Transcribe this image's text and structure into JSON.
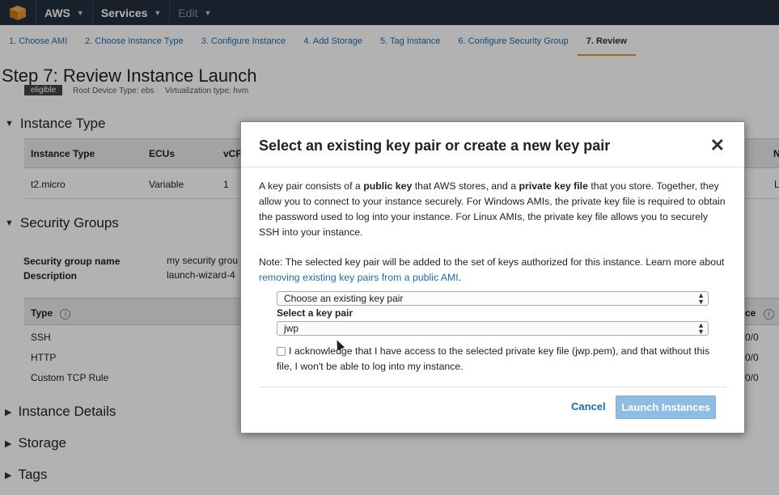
{
  "topnav": {
    "brand": "AWS",
    "services": "Services",
    "edit": "Edit"
  },
  "steps": [
    "1. Choose AMI",
    "2. Choose Instance Type",
    "3. Configure Instance",
    "4. Add Storage",
    "5. Tag Instance",
    "6. Configure Security Group",
    "7. Review"
  ],
  "page": {
    "title": "Step 7: Review Instance Launch",
    "badge": "eligible",
    "root_device": "Root Device Type: ebs",
    "virtualization": "Virtualization type: hvm",
    "instance_type_section": "Instance Type",
    "instance_table": {
      "headers": [
        "Instance Type",
        "ECUs",
        "vCP",
        "N"
      ],
      "row": [
        "t2.micro",
        "Variable",
        "1",
        "L"
      ]
    },
    "security_groups_section": "Security Groups",
    "sg_name_label": "Security group name",
    "sg_name_value": "my security grou",
    "sg_desc_label": "Description",
    "sg_desc_value": "launch-wizard-4",
    "rules_header_type": "Type",
    "rules_header_source": "ce",
    "rules": [
      {
        "type": "SSH",
        "source": "0/0"
      },
      {
        "type": "HTTP",
        "source": "0/0"
      },
      {
        "type": "Custom TCP Rule",
        "source": "0/0"
      }
    ],
    "collapsed_sections": [
      "Instance Details",
      "Storage",
      "Tags"
    ]
  },
  "modal": {
    "title": "Select an existing key pair or create a new key pair",
    "para1_a": "A key pair consists of a ",
    "para1_b": "public key",
    "para1_c": " that AWS stores, and a ",
    "para1_d": "private key file",
    "para1_e": " that you store. Together, they allow you to connect to your instance securely. For Windows AMIs, the private key file is required to obtain the password used to log into your instance. For Linux AMIs, the private key file allows you to securely SSH into your instance.",
    "note_text": "Note: The selected key pair will be added to the set of keys authorized for this instance. Learn more about ",
    "note_link": "removing existing key pairs from a public AMI",
    "note_end": ".",
    "keypair_mode": "Choose an existing key pair",
    "select_label": "Select a key pair",
    "selected_key": "jwp",
    "ack_text": "I acknowledge that I have access to the selected private key file (jwp.pem), and that without this file, I won't be able to log into my instance.",
    "cancel": "Cancel",
    "launch": "Launch Instances"
  }
}
